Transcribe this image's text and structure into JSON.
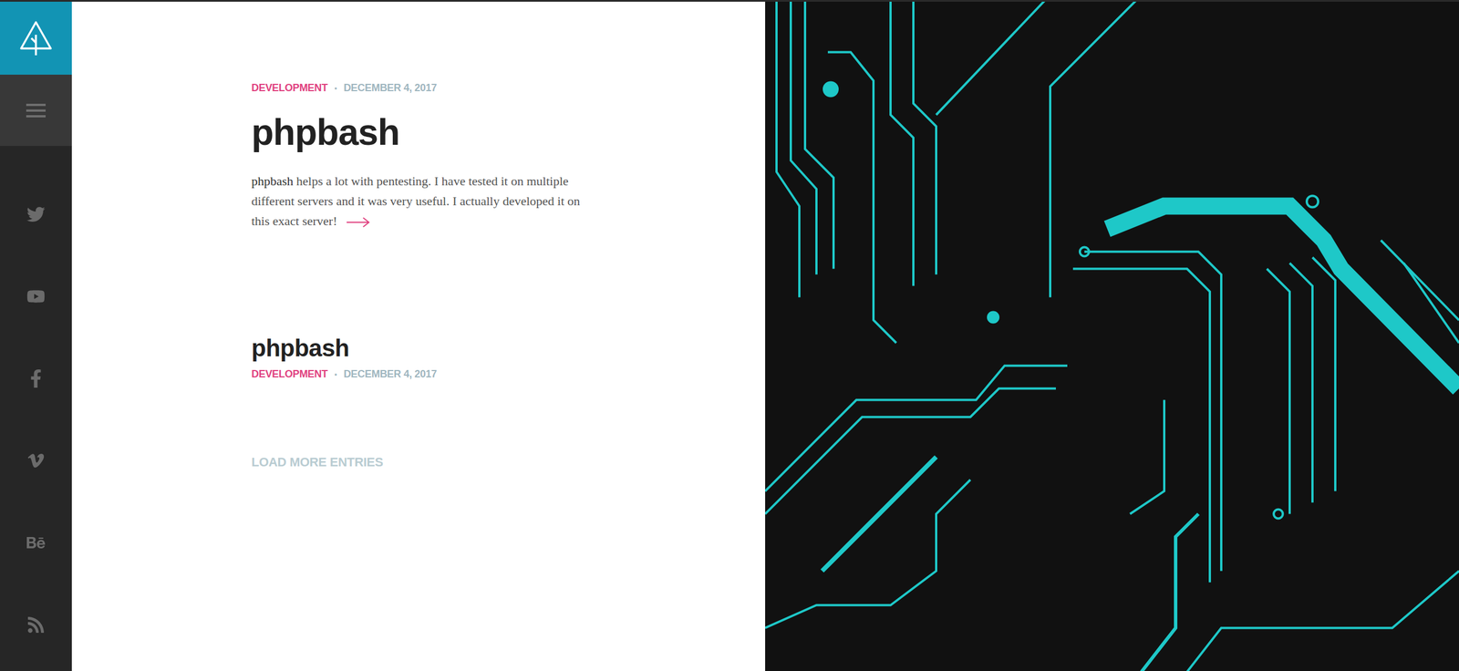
{
  "posts": [
    {
      "category": "DEVELOPMENT",
      "separator": "•",
      "date": "DECEMBER 4, 2017",
      "title": "phpbash",
      "featured": true,
      "excerpt_lead": "phpbash",
      "excerpt": " helps a lot with pentesting. I have tested it on multiple different servers and it was very useful. I actually developed it on this exact server!"
    },
    {
      "category": "DEVELOPMENT",
      "separator": "•",
      "date": "DECEMBER 4, 2017",
      "title": "phpbash",
      "featured": false,
      "excerpt_lead": "",
      "excerpt": ""
    }
  ],
  "load_more": "LOAD MORE ENTRIES"
}
